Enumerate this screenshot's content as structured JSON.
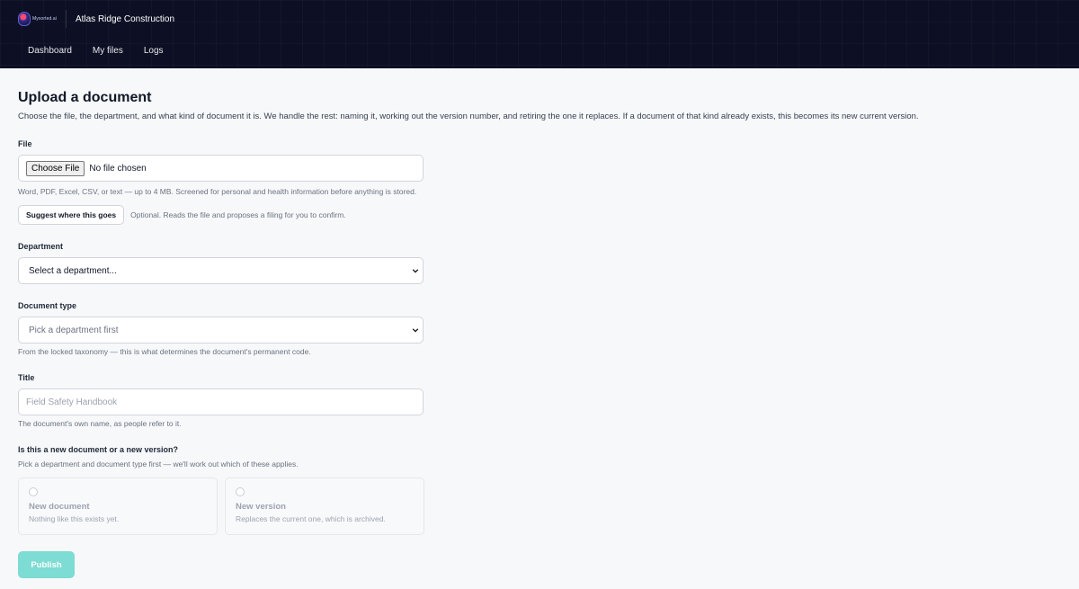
{
  "header": {
    "logo_text": "Mysorted.ai",
    "company": "Atlas Ridge Construction",
    "nav": [
      "Dashboard",
      "My files",
      "Logs"
    ]
  },
  "page": {
    "title": "Upload a document",
    "intro": "Choose the file, the department, and what kind of document it is. We handle the rest: naming it, working out the version number, and retiring the one it replaces. If a document of that kind already exists, this becomes its new current version."
  },
  "file": {
    "label": "File",
    "button": "Choose File",
    "status": "No file chosen",
    "help": "Word, PDF, Excel, CSV, or text — up to 4 MB. Screened for personal and health information before anything is stored.",
    "suggest_button": "Suggest where this goes",
    "suggest_note": "Optional. Reads the file and proposes a filing for you to confirm."
  },
  "department": {
    "label": "Department",
    "selected": "Select a department..."
  },
  "doc_type": {
    "label": "Document type",
    "selected": "Pick a department first",
    "help": "From the locked taxonomy — this is what determines the document's permanent code."
  },
  "title_field": {
    "label": "Title",
    "placeholder": "Field Safety Handbook",
    "help": "The document's own name, as people refer to it."
  },
  "version": {
    "label": "Is this a new document or a new version?",
    "help": "Pick a department and document type first — we'll work out which of these applies.",
    "options": [
      {
        "title": "New document",
        "sub": "Nothing like this exists yet."
      },
      {
        "title": "New version",
        "sub": "Replaces the current one, which is archived."
      }
    ]
  },
  "publish_label": "Publish"
}
